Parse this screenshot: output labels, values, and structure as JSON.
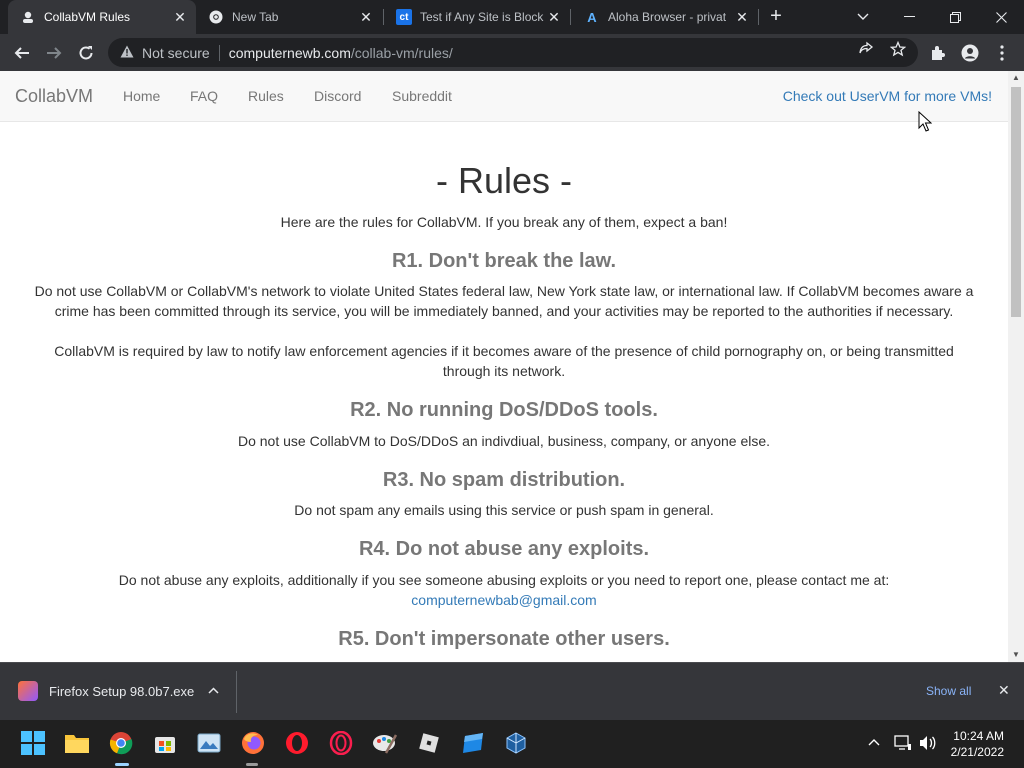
{
  "browser": {
    "tabs": [
      {
        "title": "CollabVM Rules",
        "favicon": "collabvm-icon",
        "active": true
      },
      {
        "title": "New Tab",
        "favicon": "chrome-icon",
        "active": false
      },
      {
        "title": "Test if Any Site is Block",
        "favicon": "ct-icon",
        "favicon_text": "ct",
        "active": false
      },
      {
        "title": "Aloha Browser - privat",
        "favicon": "aloha-icon",
        "favicon_text": "A",
        "active": false
      }
    ],
    "address": {
      "security_label": "Not secure",
      "host": "computernewb.com",
      "path": "/collab-vm/rules/"
    }
  },
  "site": {
    "brand": "CollabVM",
    "nav": [
      "Home",
      "FAQ",
      "Rules",
      "Discord",
      "Subreddit"
    ],
    "nav_right": "Check out UserVM for more VMs!"
  },
  "page": {
    "title": "- Rules -",
    "intro": "Here are the rules for CollabVM. If you break any of them, expect a ban!",
    "rules": [
      {
        "heading": "R1. Don't break the law.",
        "paragraphs": [
          "Do not use CollabVM or CollabVM's network to violate United States federal law, New York state law, or international law. If CollabVM becomes aware a crime has been committed through its service, you will be immediately banned, and your activities may be reported to the authorities if necessary.",
          "CollabVM is required by law to notify law enforcement agencies if it becomes aware of the presence of child pornography on, or being transmitted through its network."
        ]
      },
      {
        "heading": "R2. No running DoS/DDoS tools.",
        "paragraphs": [
          "Do not use CollabVM to DoS/DDoS an indivdiual, business, company, or anyone else."
        ]
      },
      {
        "heading": "R3. No spam distribution.",
        "paragraphs": [
          "Do not spam any emails using this service or push spam in general."
        ]
      },
      {
        "heading": "R4. Do not abuse any exploits.",
        "paragraphs": [
          "Do not abuse any exploits, additionally if you see someone abusing exploits or you need to report one, please contact me at:"
        ],
        "contact_email": "computernewbab@gmail.com"
      },
      {
        "heading": "R5. Don't impersonate other users.",
        "paragraphs": []
      }
    ]
  },
  "downloads": {
    "file_name": "Firefox Setup 98.0b7.exe",
    "show_all": "Show all"
  },
  "taskbar": {
    "time": "10:24 AM",
    "date": "2/21/2022"
  }
}
